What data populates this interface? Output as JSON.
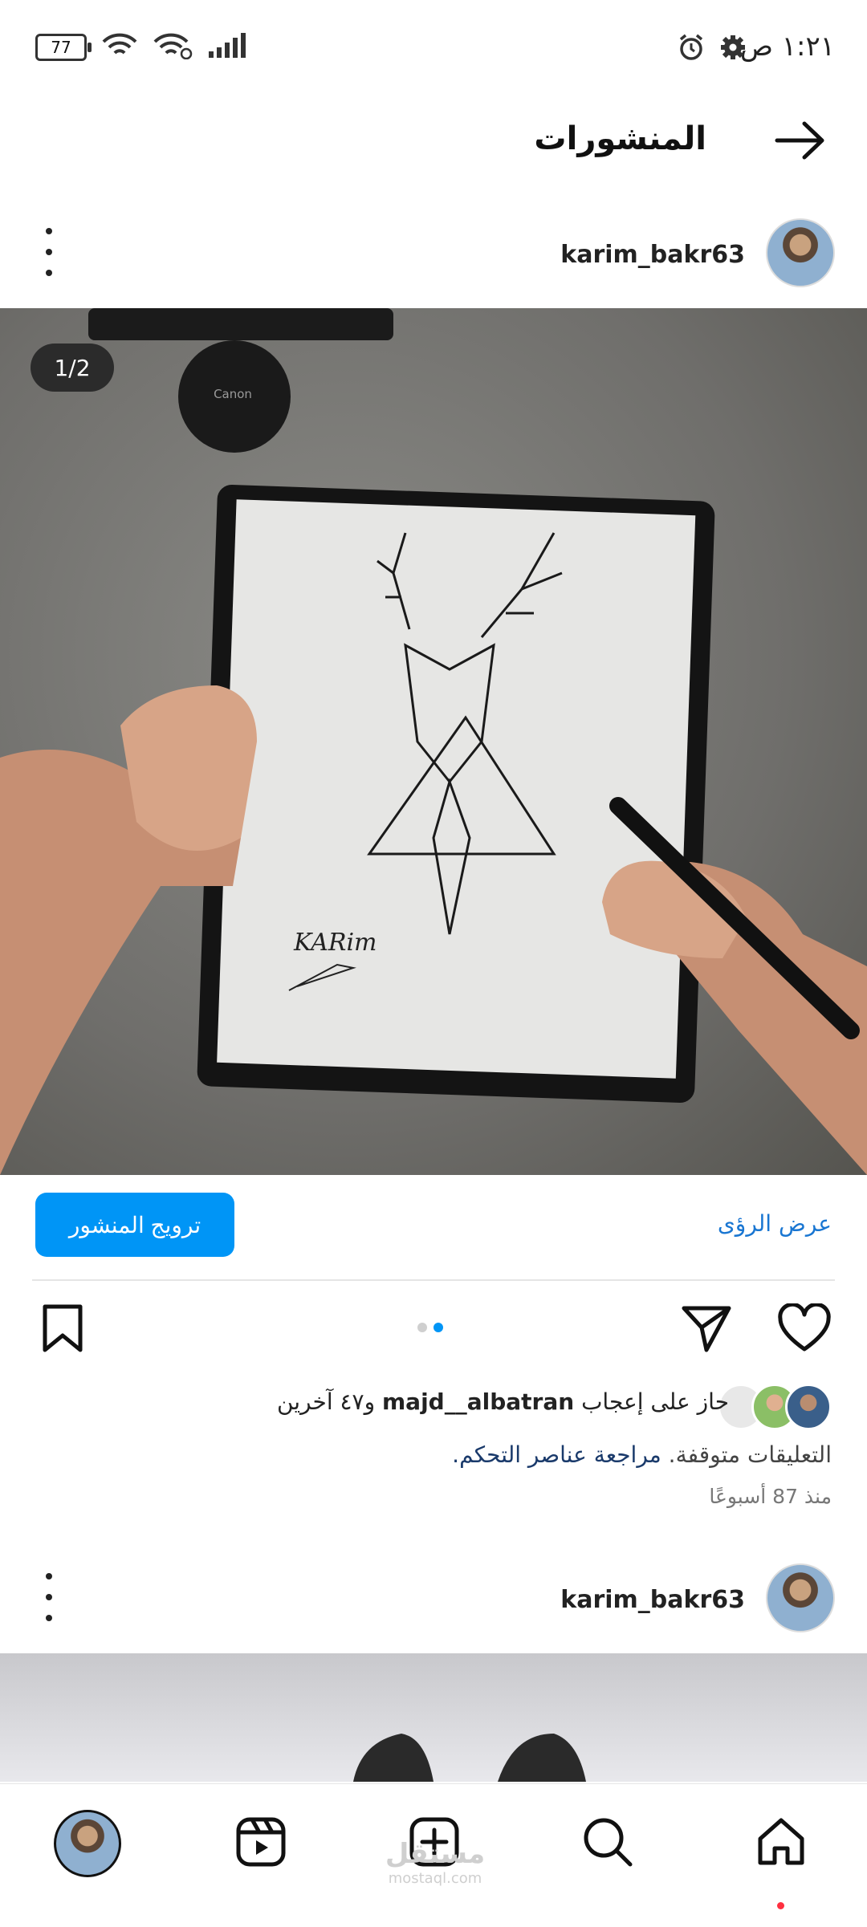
{
  "status_bar": {
    "time": "١:٢١ ص",
    "battery": "77",
    "icons": [
      "gear-icon",
      "alarm-icon",
      "wifi-icon",
      "wifi-call-icon",
      "signal-icon"
    ]
  },
  "header": {
    "title": "المنشورات",
    "back_icon": "arrow-right-icon"
  },
  "post1": {
    "username": "karim_bakr63",
    "image_counter": "1/2",
    "image_label": "Canon",
    "image_signature": "KARim",
    "promote_label": "ترويج المنشور",
    "insights_label": "عرض الرؤى",
    "likes_prefix": "حاز على إعجاب ",
    "likes_user": "majd__albatran",
    "likes_suffix": " و٤٧ آخرين",
    "comments_off": "التعليقات متوقفة. ",
    "review_controls": "مراجعة عناصر التحكم.",
    "timestamp": "منذ 87 أسبوعًا",
    "carousel_active_index": 1,
    "carousel_count": 2
  },
  "post2": {
    "username": "karim_bakr63"
  },
  "bottom_nav": {
    "items": [
      "profile",
      "reels",
      "create",
      "search",
      "home"
    ]
  },
  "watermark": {
    "text": "مستقل",
    "sub": "mostaql.com"
  },
  "colors": {
    "accent": "#0095f6",
    "link": "#1976d2",
    "notification": "#ff3040"
  }
}
